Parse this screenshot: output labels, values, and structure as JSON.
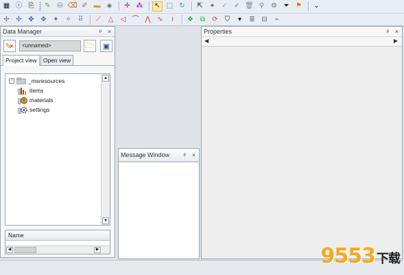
{
  "toolbar": {
    "row1_icons": [
      "grid-icon",
      "info-icon",
      "export-icon",
      "pen-icon",
      "database-icon",
      "eraser-icon",
      "paintbrush-icon",
      "ruler-icon",
      "tag-icon",
      "move-points-icon",
      "cursor-select-icon",
      "shape-select-icon",
      "node-select-icon",
      "check-icon",
      "undo-check-icon",
      "delete-icon",
      "lock-icon",
      "settings-icon",
      "filter-icon",
      "bookmark-icon"
    ],
    "row2_icons": [
      "add-point-icon",
      "move-point-icon",
      "remove-point-icon",
      "insert-node-icon",
      "grid-snap-icon",
      "polyline-icon",
      "polygon-icon",
      "curve-icon",
      "zigzag-icon",
      "wave-icon",
      "group-icon",
      "layers-icon",
      "rotate-icon",
      "shield-icon",
      "stack-icon",
      "split-icon"
    ]
  },
  "data_manager": {
    "title": "Data Manager",
    "combo_value": "<unnamed>",
    "tabs": [
      {
        "label": "Project view",
        "active": true
      },
      {
        "label": "Open view",
        "active": false
      }
    ],
    "tree": {
      "root": {
        "label": "_msresources",
        "expander": "−"
      },
      "children": [
        {
          "label": "items",
          "icon": "bar-chart-icon"
        },
        {
          "label": "materials",
          "icon": "material-ball-icon"
        },
        {
          "label": "settings",
          "icon": "settings-gear-icon"
        }
      ]
    },
    "list_header": "Name"
  },
  "message_window": {
    "title": "Message Window"
  },
  "properties": {
    "title": "Properties"
  },
  "panel_controls": {
    "pin": "ᵖ",
    "close": "×"
  },
  "watermark": {
    "number": "9553",
    "suffix": "下载"
  }
}
